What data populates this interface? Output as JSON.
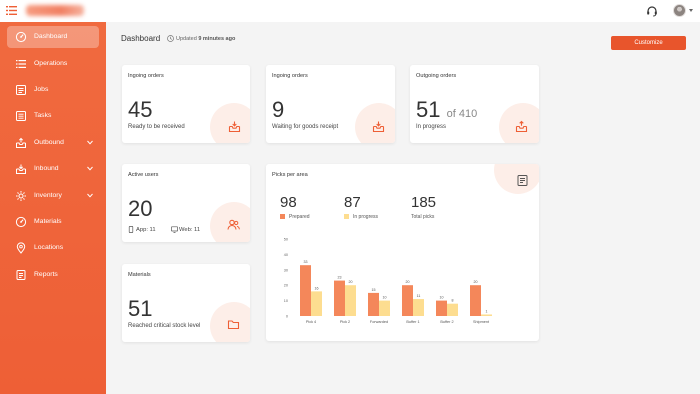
{
  "app": {
    "colors": {
      "accent": "#ee5f36",
      "accent_dark": "#e8552c",
      "bar_prepared": "#f4875a",
      "bar_in_progress": "#fddd90",
      "deco": "#fdeee8"
    }
  },
  "topbar": {
    "menu_icon": "hamburger-icon",
    "support_icon": "headset-icon",
    "avatar_icon": "user-avatar"
  },
  "sidebar": {
    "items": [
      {
        "label": "Dashboard",
        "icon": "gauge-icon",
        "active": true
      },
      {
        "label": "Operations",
        "icon": "list-icon"
      },
      {
        "label": "Jobs",
        "icon": "jobs-icon"
      },
      {
        "label": "Tasks",
        "icon": "tasks-icon"
      },
      {
        "label": "Outbound",
        "icon": "outbound-icon",
        "expandable": true
      },
      {
        "label": "Inbound",
        "icon": "inbound-icon",
        "expandable": true
      },
      {
        "label": "Inventory",
        "icon": "inventory-icon",
        "expandable": true
      },
      {
        "label": "Materials",
        "icon": "materials-icon"
      },
      {
        "label": "Locations",
        "icon": "location-pin-icon"
      },
      {
        "label": "Reports",
        "icon": "reports-icon"
      }
    ]
  },
  "header": {
    "title": "Dashboard",
    "updated_prefix": "Updated",
    "updated_value": "9 minutes ago",
    "customize_label": "Customize"
  },
  "cards": {
    "ingoing_received": {
      "title": "Ingoing orders",
      "value": "45",
      "subtitle": "Ready to be received",
      "icon": "inbox-icon"
    },
    "ingoing_waiting": {
      "title": "Ingoing orders",
      "value": "9",
      "subtitle": "Waiting for goods receipt",
      "icon": "inbox-icon"
    },
    "outgoing": {
      "title": "Outgoing orders",
      "value": "51",
      "of_total": "of 410",
      "subtitle": "In progress",
      "icon": "inbox-icon"
    },
    "active_users": {
      "title": "Active users",
      "value": "20",
      "app_label": "App: 11",
      "web_label": "Web: 11",
      "icon": "users-icon"
    },
    "materials": {
      "title": "Materials",
      "value": "51",
      "subtitle": "Reached critical stock level",
      "icon": "folder-icon"
    }
  },
  "picks": {
    "title": "Picks per area",
    "icon": "report-icon",
    "prepared_value": "98",
    "prepared_label": "Prepared",
    "in_progress_value": "87",
    "in_progress_label": "In progress",
    "total_value": "185",
    "total_label": "Total picks"
  },
  "chart_data": {
    "type": "bar",
    "categories": [
      "Pick 4",
      "Pick 2",
      "Forwarded",
      "Buffer 1",
      "Buffer 2",
      "Shipment"
    ],
    "series": [
      {
        "name": "Prepared",
        "values": [
          33,
          23,
          15,
          20,
          10,
          20
        ]
      },
      {
        "name": "In progress",
        "values": [
          16,
          20,
          10,
          11,
          8,
          1
        ]
      }
    ],
    "y_ticks": [
      "50",
      "40",
      "30",
      "20",
      "10",
      "0"
    ],
    "ylim": [
      0,
      50
    ],
    "grid": false,
    "legend": "top"
  }
}
